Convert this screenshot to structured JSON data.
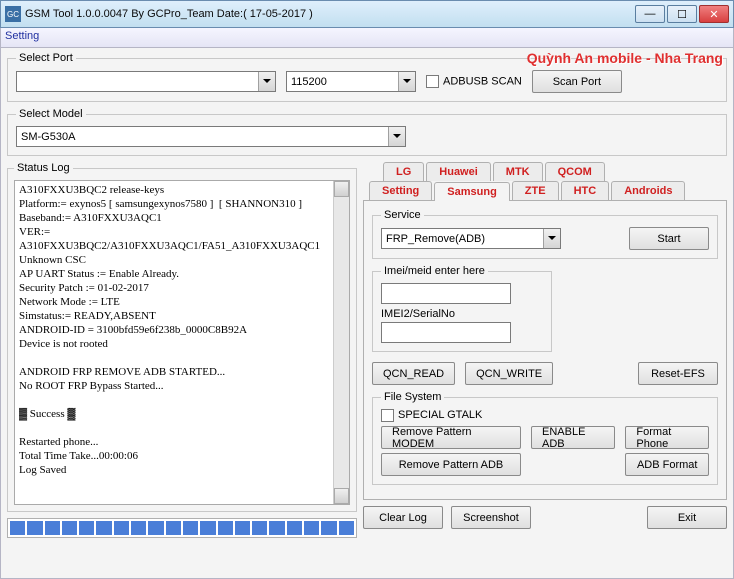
{
  "window": {
    "title": "GSM Tool 1.0.0.0047 By GCPro_Team  Date:( 17-05-2017 )",
    "watermark": "Quỳnh An mobile - Nha Trang"
  },
  "menu": {
    "setting": "Setting"
  },
  "selectPort": {
    "legend": "Select Port",
    "port": "",
    "baud": "115200",
    "adbusb": "ADBUSB SCAN",
    "scan": "Scan Port"
  },
  "selectModel": {
    "legend": "Select Model",
    "value": "SM-G530A"
  },
  "statusLog": {
    "legend": "Status Log",
    "text": "A310FXXU3BQC2 release-keys\nPlatform:= exynos5 [ samsungexynos7580 ]  [ SHANNON310 ]\nBaseband:= A310FXXU3AQC1\nVER:= A310FXXU3BQC2/A310FXXU3AQC1/FA51_A310FXXU3AQC1\nUnknown CSC\nAP UART Status := Enable Already.\nSecurity Patch := 01-02-2017\nNetwork Mode := LTE\nSimstatus:= READY,ABSENT\nANDROID-ID = 3100bfd59e6f238b_0000C8B92A\nDevice is not rooted\n\nANDROID FRP REMOVE ADB STARTED...\nNo ROOT FRP Bypass Started...\n\n▓ Success ▓\n\nRestarted phone...\nTotal Time Take...00:00:06\nLog Saved"
  },
  "tabs": {
    "row1": [
      "LG",
      "Huawei",
      "MTK",
      "QCOM"
    ],
    "row2": [
      "Setting",
      "Samsung",
      "ZTE",
      "HTC",
      "Androids"
    ],
    "active": "Samsung"
  },
  "service": {
    "legend": "Service",
    "value": "FRP_Remove(ADB)",
    "start": "Start"
  },
  "imei": {
    "label1": "Imei/meid enter here",
    "label2": "IMEI2/SerialNo",
    "v1": "",
    "v2": ""
  },
  "qcn": {
    "read": "QCN_READ",
    "write": "QCN_WRITE",
    "reset": "Reset-EFS"
  },
  "fs": {
    "legend": "File System",
    "gtalk": "SPECIAL GTALK",
    "rpm": "Remove Pattern MODEM",
    "rpa": "Remove Pattern ADB",
    "enable": "ENABLE ADB",
    "format": "Format Phone",
    "adbformat": "ADB Format"
  },
  "bottom": {
    "clear": "Clear Log",
    "shot": "Screenshot",
    "exit": "Exit"
  }
}
